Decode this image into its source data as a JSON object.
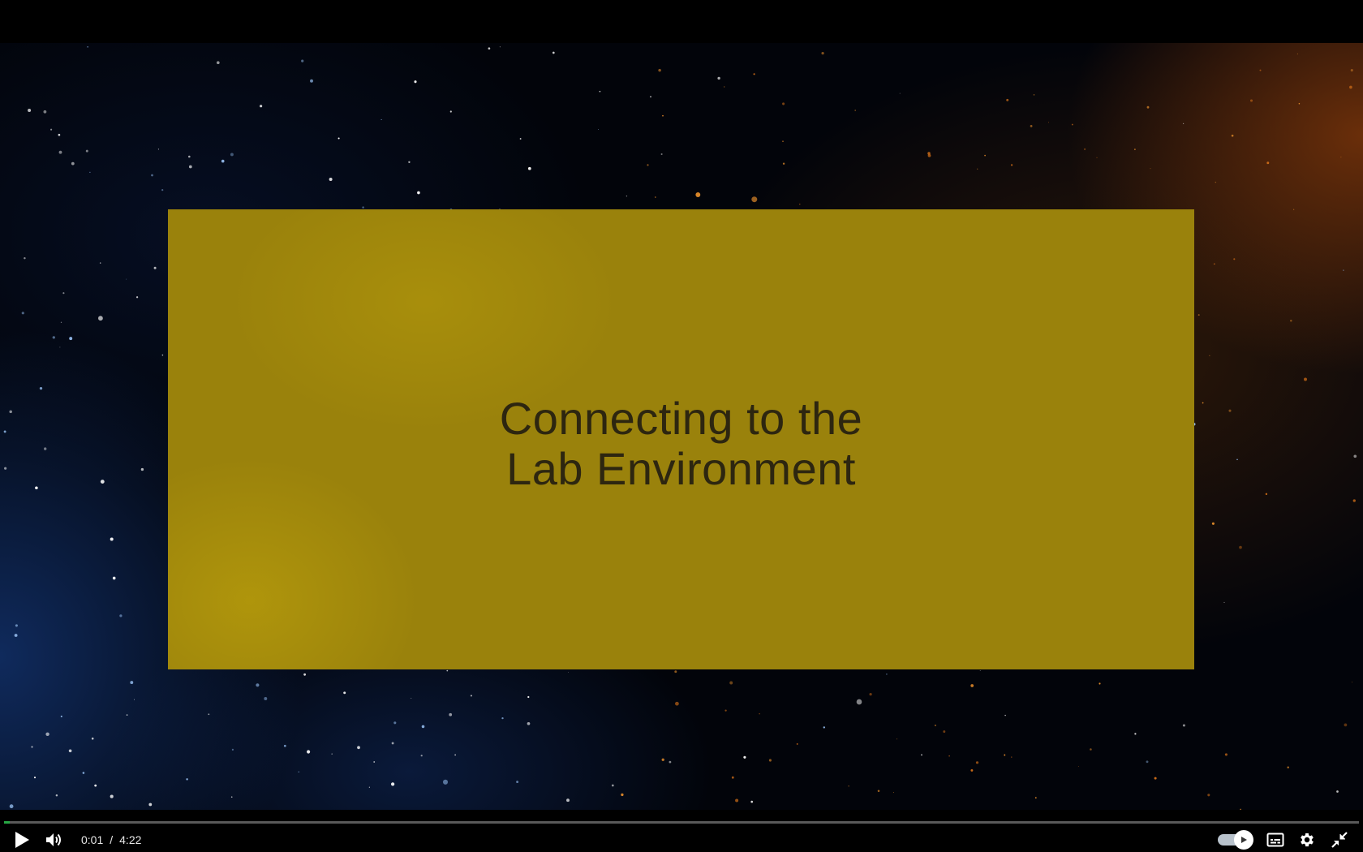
{
  "video": {
    "title_card_text": "Connecting to the\nLab Environment",
    "card_color": "#9a820c",
    "title_text_color": "#2d2610"
  },
  "controls": {
    "current_time": "0:01",
    "separator": "/",
    "duration": "4:22",
    "progress_fraction": 0.004,
    "progress_color": "#27a844",
    "autoplay_on": true,
    "icons": [
      "play-icon",
      "volume-icon",
      "autoplay-toggle-icon",
      "captions-icon",
      "gear-icon",
      "exit-fullscreen-icon"
    ]
  }
}
